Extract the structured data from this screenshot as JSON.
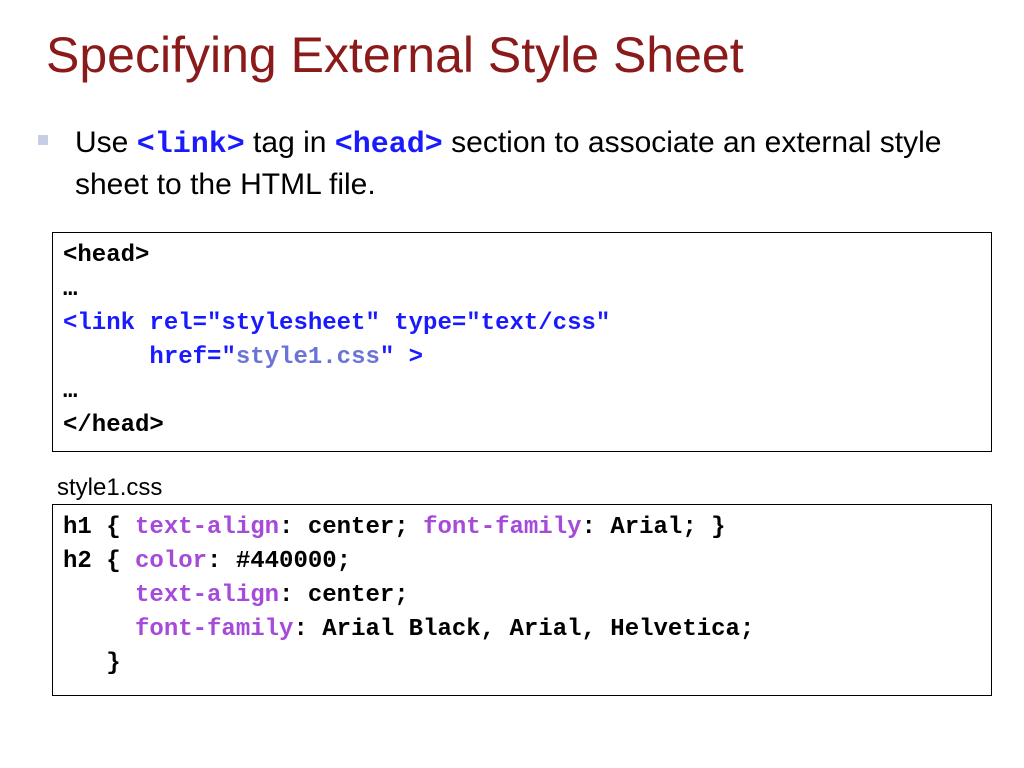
{
  "slide": {
    "title": "Specifying External Style Sheet"
  },
  "bullet": {
    "prefix": "Use ",
    "code1": "<link>",
    "mid": " tag in ",
    "code2": "<head>",
    "suffix": " section to associate an external style sheet to the HTML file."
  },
  "html_example": {
    "line1": "<head>",
    "line2": "…",
    "line3": "<link rel=\"stylesheet\" type=\"text/css\"",
    "line4_indent": "      href=",
    "line4_quote_open": "\"",
    "line4_value": "style1.css",
    "line4_end": "\" >",
    "line5": "…",
    "line6": "</head>"
  },
  "css_example": {
    "caption": "style1.css",
    "l1_a": "h1 { ",
    "l1_prop1": "text-align",
    "l1_b": ": center; ",
    "l1_prop2": "font-family",
    "l1_c": ": Arial; }",
    "l2_a": "h2 { ",
    "l2_prop": "color",
    "l2_b": ": #440000;",
    "l3_indent": "     ",
    "l3_prop": "text-align",
    "l3_b": ": center;",
    "l4_indent": "     ",
    "l4_prop": "font-family",
    "l4_b": ": Arial Black, Arial, Helvetica;",
    "l5": "   }"
  },
  "colors": {
    "title": "#8b1a1a",
    "code_blue": "#1a1aff",
    "string_value": "#6b74d6",
    "property": "#a64ad9",
    "bullet": "#c7cde6"
  }
}
